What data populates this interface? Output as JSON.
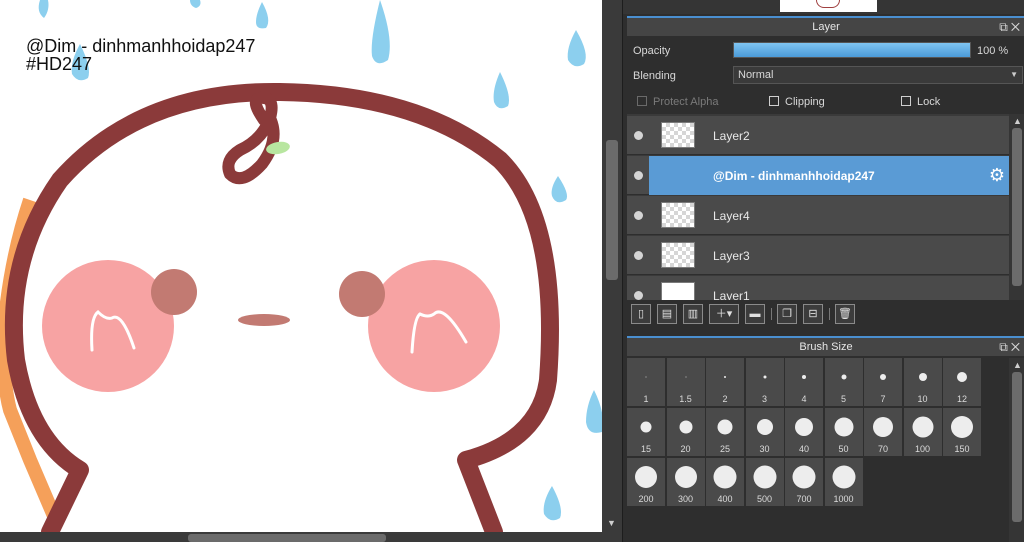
{
  "watermark": {
    "line1": "@Dim - dinhmanhhoidap247",
    "line2": "#HD247"
  },
  "layer_panel": {
    "title": "Layer",
    "opacity_label": "Opacity",
    "opacity_value": "100 %",
    "opacity_fraction": 1.0,
    "blending_label": "Blending",
    "blending_value": "Normal",
    "protect_alpha_label": "Protect Alpha",
    "clipping_label": "Clipping",
    "lock_label": "Lock",
    "layers": [
      {
        "name": "Layer2",
        "selected": false
      },
      {
        "name": "@Dim - dinhmanhhoidap247",
        "selected": true
      },
      {
        "name": "Layer4",
        "selected": false
      },
      {
        "name": "Layer3",
        "selected": false
      },
      {
        "name": "Layer1",
        "selected": false
      }
    ]
  },
  "brush_panel": {
    "title": "Brush Size",
    "sizes": [
      "1",
      "1.5",
      "2",
      "3",
      "4",
      "5",
      "7",
      "10",
      "12",
      "15",
      "20",
      "25",
      "30",
      "40",
      "50",
      "70",
      "100",
      "150",
      "200",
      "300",
      "400",
      "500",
      "700",
      "1000"
    ]
  },
  "icons": {
    "panel_float": "float-window-icon",
    "panel_close": "close-icon",
    "layer_gear": "gear-icon"
  },
  "colors": {
    "accent": "#5a9bd5",
    "outline": "#8b3a3a",
    "cheek": "#f7a3a3",
    "eye": "#c27a72",
    "raindrop": "#8ccfee",
    "leaf": "#b8e6a0",
    "edge_shadow": "#f5a05a"
  }
}
